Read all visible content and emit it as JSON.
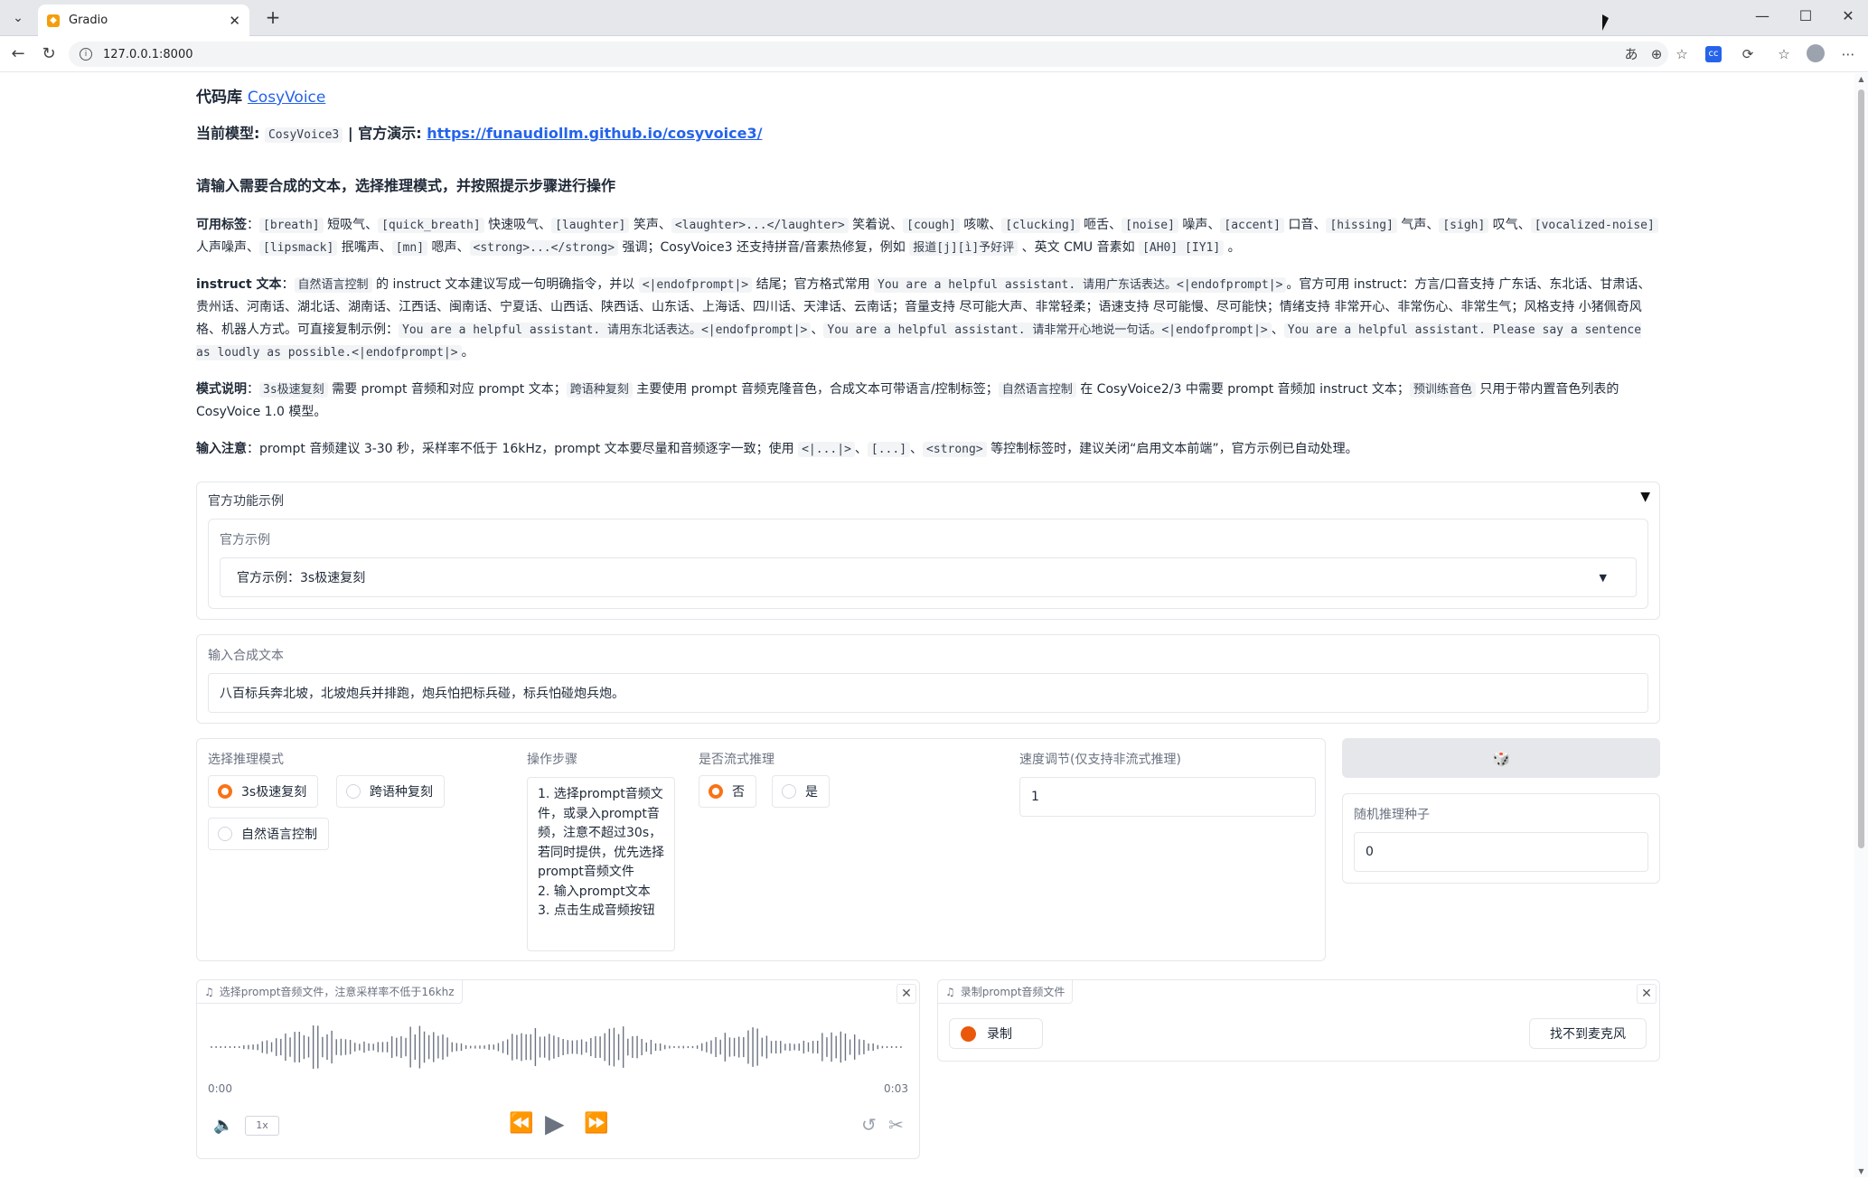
{
  "browser": {
    "tab_title": "Gradio",
    "url": "127.0.0.1:8000"
  },
  "header": {
    "repo_prefix": "代码库",
    "repo_link": "CosyVoice",
    "model_label": "当前模型:",
    "model_name": "CosyVoice3",
    "sep": "|",
    "demo_label": "官方演示:",
    "demo_link": "https://funaudiollm.github.io/cosyvoice3/",
    "instruction_heading": "请输入需要合成的文本，选择推理模式，并按照提示步骤进行操作"
  },
  "notes": {
    "tags_label": "可用标签",
    "tags_parts": [
      "[breath]",
      " 短吸气、",
      "[quick_breath]",
      " 快速吸气、",
      "[laughter]",
      " 笑声、",
      "<laughter>...</laughter>",
      " 笑着说、",
      "[cough]",
      " 咳嗽、",
      "[clucking]",
      " 咂舌、",
      "[noise]",
      " 噪声、",
      "[accent]",
      " 口音、",
      "[hissing]",
      " 气声、",
      "[sigh]",
      " 叹气、",
      "[vocalized-noise]",
      " 人声噪声、",
      "[lipsmack]",
      " 抿嘴声、",
      "[mn]",
      " 嗯声、",
      "<strong>...</strong>",
      " 强调；CosyVoice3 还支持拼音/音素热修复，例如 ",
      "报道[j][ì]予好评",
      " 、英文 CMU 音素如 ",
      "[AH0] [IY1]",
      " 。"
    ],
    "instruct_label": "instruct 文本",
    "instruct_parts": [
      "自然语言控制",
      " 的 instruct 文本建议写成一句明确指令，并以 ",
      "<|endofprompt|>",
      " 结尾；官方格式常用 ",
      "You are a helpful assistant. 请用广东话表达。<|endofprompt|>",
      "。官方可用 instruct：方言/口音支持 广东话、东北话、甘肃话、贵州话、河南话、湖北话、湖南话、江西话、闽南话、宁夏话、山西话、陕西话、山东话、上海话、四川话、天津话、云南话；音量支持 尽可能大声、非常轻柔；语速支持 尽可能慢、尽可能快；情绪支持 非常开心、非常伤心、非常生气；风格支持 小猪佩奇风格、机器人方式。可直接复制示例：",
      "You are a helpful assistant. 请用东北话表达。<|endofprompt|>",
      "、",
      "You are a helpful assistant. 请非常开心地说一句话。<|endofprompt|>",
      "、",
      "You are a helpful assistant. Please say a sentence as loudly as possible.<|endofprompt|>",
      "。"
    ],
    "mode_label": "模式说明",
    "mode_parts": [
      "3s极速复刻",
      " 需要 prompt 音频和对应 prompt 文本；",
      "跨语种复刻",
      " 主要使用 prompt 音频克隆音色，合成文本可带语言/控制标签；",
      "自然语言控制",
      " 在 CosyVoice2/3 中需要 prompt 音频加 instruct 文本；",
      "预训练音色",
      " 只用于带内置音色列表的 CosyVoice 1.0 模型。"
    ],
    "input_label": "输入注意",
    "input_parts": [
      "prompt 音频建议 3-30 秒，采样率不低于 16kHz，prompt 文本要尽量和音频逐字一致；使用 ",
      "<|...|>",
      "、",
      "[...]",
      "、",
      "<strong>",
      " 等控制标签时，建议关闭“启用文本前端”，官方示例已自动处理。"
    ]
  },
  "examples": {
    "accordion_title": "官方功能示例",
    "toggle_icon": "▼",
    "dropdown_label": "官方示例",
    "dropdown_value": "官方示例：3s极速复刻",
    "dropdown_icon": "chevron-down-icon"
  },
  "tts_text": {
    "label": "输入合成文本",
    "value": "八百标兵奔北坡，北坡炮兵并排跑，炮兵怕把标兵碰，标兵怕碰炮兵炮。"
  },
  "mode": {
    "label": "选择推理模式",
    "options": [
      "3s极速复刻",
      "跨语种复刻",
      "自然语言控制"
    ],
    "selected": "3s极速复刻"
  },
  "steps": {
    "label": "操作步骤",
    "text": "1. 选择prompt音频文件，或录入prompt音频，注意不超过30s，若同时提供，优先选择prompt音频文件\n2. 输入prompt文本\n3. 点击生成音频按钮"
  },
  "stream": {
    "label": "是否流式推理",
    "options": [
      "否",
      "是"
    ],
    "selected": "否"
  },
  "speed": {
    "label": "速度调节(仅支持非流式推理)",
    "value": "1"
  },
  "seed": {
    "button_icon": "dice-icon",
    "label": "随机推理种子",
    "value": "0"
  },
  "upload_audio": {
    "label": "选择prompt音频文件，注意采样率不低于16khz",
    "time_start": "0:00",
    "time_end": "0:03",
    "speed_label": "1x",
    "colors": {
      "waveform": "#6b7280"
    }
  },
  "record_audio": {
    "label": "录制prompt音频文件",
    "record_button": "录制",
    "mic_button": "找不到麦克风",
    "colors": {
      "record_dot": "#ea580c"
    }
  }
}
